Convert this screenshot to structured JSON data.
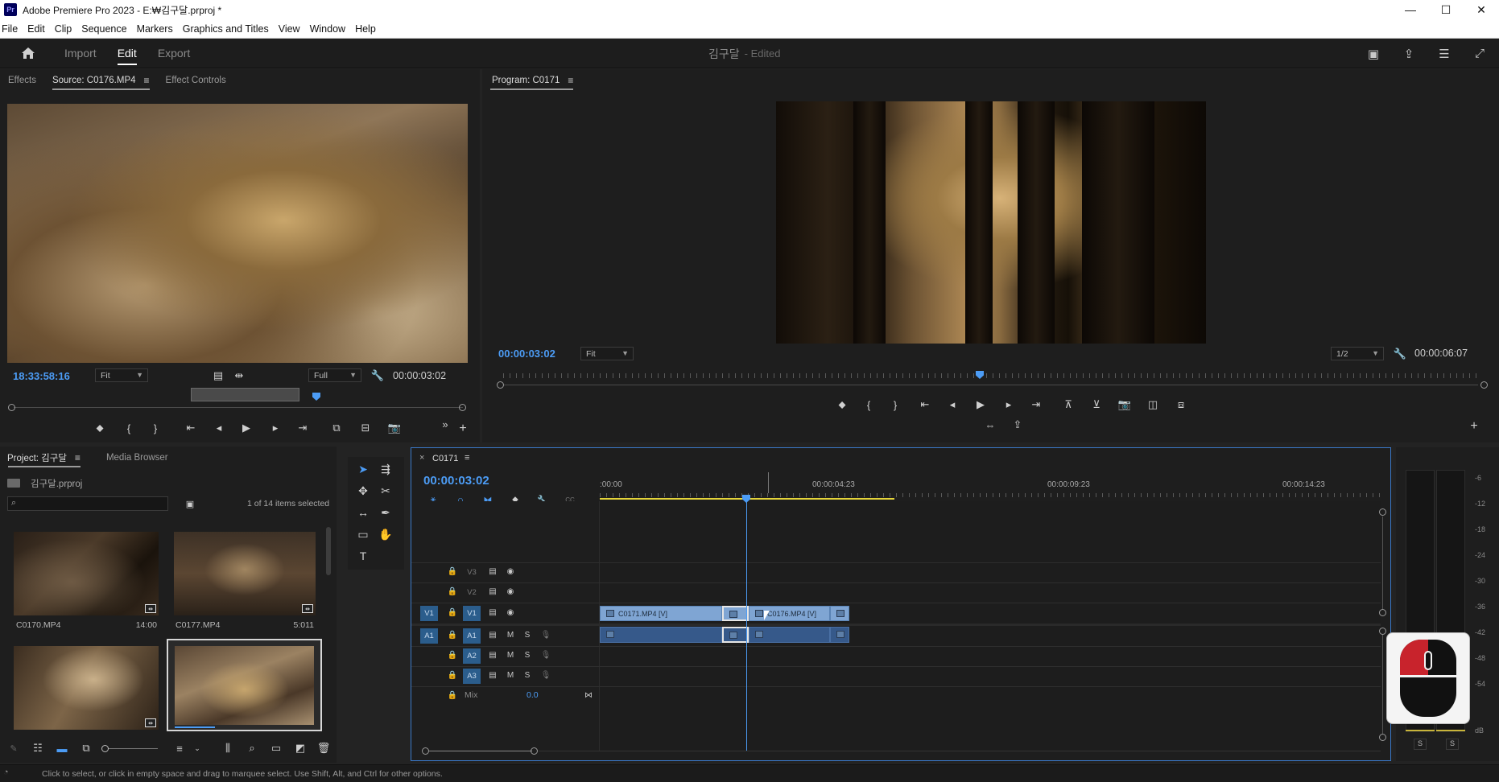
{
  "window": {
    "title": "Adobe Premiere Pro 2023 - E:₩김구달.prproj *",
    "app_icon_label": "Pr",
    "minimize": "—",
    "maximize": "☐",
    "close": "✕"
  },
  "menu": [
    "File",
    "Edit",
    "Clip",
    "Sequence",
    "Markers",
    "Graphics and Titles",
    "View",
    "Window",
    "Help"
  ],
  "header": {
    "tabs": [
      "Import",
      "Edit",
      "Export"
    ],
    "active_tab": "Edit",
    "project_name": "김구달",
    "edited": "- Edited"
  },
  "source_panel": {
    "tabs": [
      "Effects",
      "Source: C0176.MP4",
      "Effect Controls"
    ],
    "active_tab": "Source: C0176.MP4",
    "timecode_left": "18:33:58:16",
    "zoom": "Fit",
    "resolution": "Full",
    "timecode_right": "00:00:03:02",
    "more": "»",
    "add": "+"
  },
  "program_panel": {
    "title": "Program: C0171",
    "timecode_left": "00:00:03:02",
    "zoom": "Fit",
    "resolution": "1/2",
    "timecode_right": "00:00:06:07",
    "add": "+"
  },
  "project_panel": {
    "tabs": [
      "Project: 김구달",
      "Media Browser"
    ],
    "project_file": "김구달.prproj",
    "selection_status": "1 of 14 items selected",
    "items": [
      {
        "name": "C0170.MP4",
        "duration": "14:00"
      },
      {
        "name": "C0177.MP4",
        "duration": "5:011"
      },
      {
        "name": "",
        "duration": ""
      },
      {
        "name": "",
        "duration": ""
      }
    ]
  },
  "timeline": {
    "sequence_name": "C0171",
    "close": "×",
    "timecode": "00:00:03:02",
    "ruler_labels": [
      ":00:00",
      "00:00:04:23",
      "00:00:09:23",
      "00:00:14:23"
    ],
    "video_tracks": [
      {
        "name": "V3",
        "source": ""
      },
      {
        "name": "V2",
        "source": ""
      },
      {
        "name": "V1",
        "source": "V1"
      }
    ],
    "audio_tracks": [
      {
        "name": "A1",
        "source": "A1"
      },
      {
        "name": "A2",
        "source": ""
      },
      {
        "name": "A3",
        "source": ""
      }
    ],
    "mix_label": "Mix",
    "mix_value": "0.0",
    "mute": "M",
    "solo": "S",
    "clips": {
      "v1_clip1": "C0171.MP4 [V]",
      "v1_clip2": "C0176.MP4 [V]"
    }
  },
  "audio_meter": {
    "scale": [
      "-6",
      "-12",
      "-18",
      "-24",
      "-30",
      "-36",
      "-42",
      "-48",
      "-54",
      "dB"
    ],
    "solo_left": "S",
    "solo_right": "S"
  },
  "status_bar": "Click to select, or click in empty space and drag to marquee select. Use Shift, Alt, and Ctrl for other options.",
  "colors": {
    "accent_blue": "#4c9cf5",
    "clip_video": "#7fa5d3",
    "clip_audio": "#36598a",
    "work_area": "#e4d43a"
  }
}
